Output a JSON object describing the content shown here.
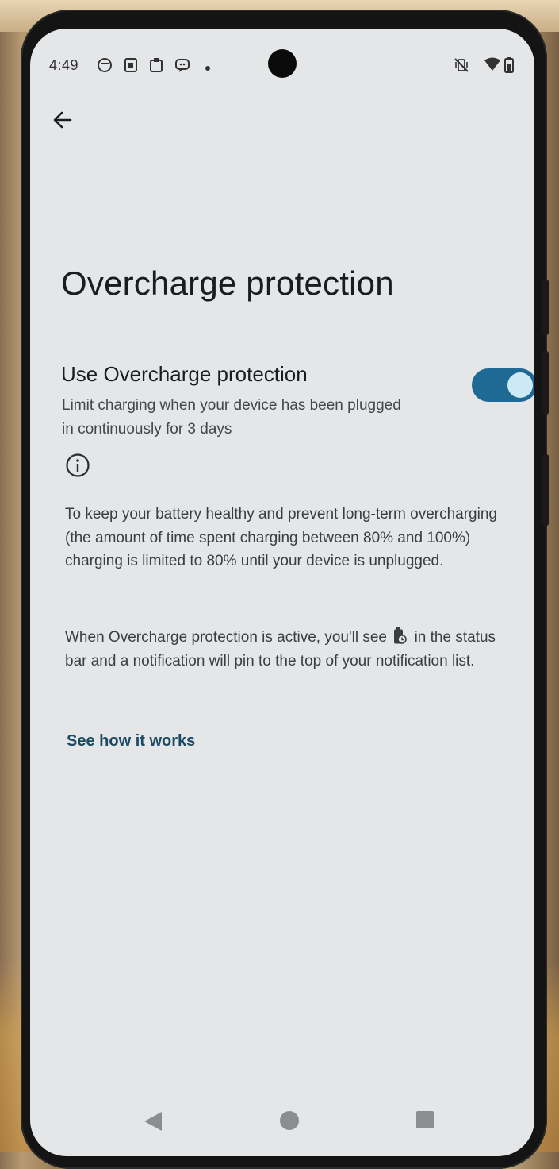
{
  "status_bar": {
    "time": "4:49",
    "left_icons": [
      "shield-icon",
      "sim-icon",
      "clipboard-icon",
      "message-icon",
      "dot-icon"
    ],
    "right_icons": [
      "vibrate-off-icon",
      "wifi-icon",
      "battery-icon"
    ]
  },
  "header": {
    "back_icon": "arrow-back-icon"
  },
  "page": {
    "title": "Overcharge protection"
  },
  "setting": {
    "title": "Use Overcharge protection",
    "summary": "Limit charging when your device has been plugged in continuously for 3 days",
    "enabled": true,
    "accent_color": "#1e6a94"
  },
  "info": {
    "icon": "info-icon",
    "paragraph1": "To keep your battery healthy and prevent long-term overcharging (the amount of time spent charging between 80% and 100%) charging is limited to 80% until your device is unplugged.",
    "paragraph2_before": "When Overcharge protection is active, you'll see",
    "paragraph2_icon": "battery-protect-icon",
    "paragraph2_after": "in the status bar and a notification will pin to the top of your notification list.",
    "link": "See how it works"
  },
  "nav_bar": {
    "buttons": [
      "nav-back-icon",
      "nav-home-icon",
      "nav-recents-icon"
    ]
  }
}
